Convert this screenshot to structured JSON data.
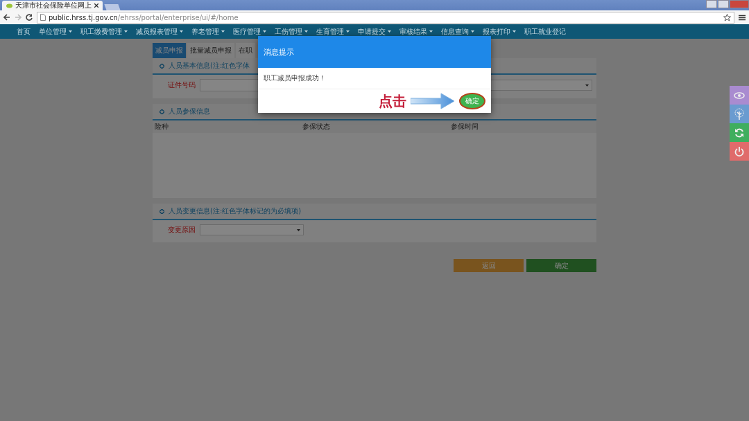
{
  "browser": {
    "tab_title": "天津市社会保险单位网上",
    "url_host": "public.hrss.tj.gov.cn",
    "url_path": "/ehrss/portal/enterprise/ui/#/home"
  },
  "nav": [
    {
      "label": "首页",
      "dropdown": false
    },
    {
      "label": "单位管理",
      "dropdown": true
    },
    {
      "label": "职工缴费管理",
      "dropdown": true
    },
    {
      "label": "减员报表管理",
      "dropdown": true
    },
    {
      "label": "养老管理",
      "dropdown": true
    },
    {
      "label": "医疗管理",
      "dropdown": true
    },
    {
      "label": "工伤管理",
      "dropdown": true
    },
    {
      "label": "生育管理",
      "dropdown": true
    },
    {
      "label": "申请提交",
      "dropdown": true
    },
    {
      "label": "审核结果",
      "dropdown": true
    },
    {
      "label": "信息查询",
      "dropdown": true
    },
    {
      "label": "报表打印",
      "dropdown": true
    },
    {
      "label": "职工就业登记",
      "dropdown": false
    }
  ],
  "tabs": [
    {
      "label": "减员申报",
      "selected": true
    },
    {
      "label": "批量减员申报",
      "selected": false
    },
    {
      "label": "在职",
      "selected": false
    }
  ],
  "sections": [
    {
      "kind": "form",
      "title": "人员基本信息(注:红色字体",
      "fields": [
        {
          "label": "证件号码",
          "kind": "input"
        },
        {
          "kind": "wide-select"
        }
      ]
    },
    {
      "kind": "table",
      "title": "人员参保信息",
      "columns": [
        "险种",
        "参保状态",
        "参保时间"
      ]
    },
    {
      "kind": "form",
      "title": "人员变更信息(注:红色字体标记的为必填项)",
      "fields": [
        {
          "label": "变更原因",
          "kind": "select"
        }
      ]
    }
  ],
  "actions": [
    {
      "label": "返回",
      "kind": "back"
    },
    {
      "label": "确定",
      "kind": "confirm"
    }
  ],
  "modal": {
    "title": "消息提示",
    "message": "职工减员申报成功！",
    "button": "确定"
  },
  "annotation": {
    "text": "点击"
  }
}
